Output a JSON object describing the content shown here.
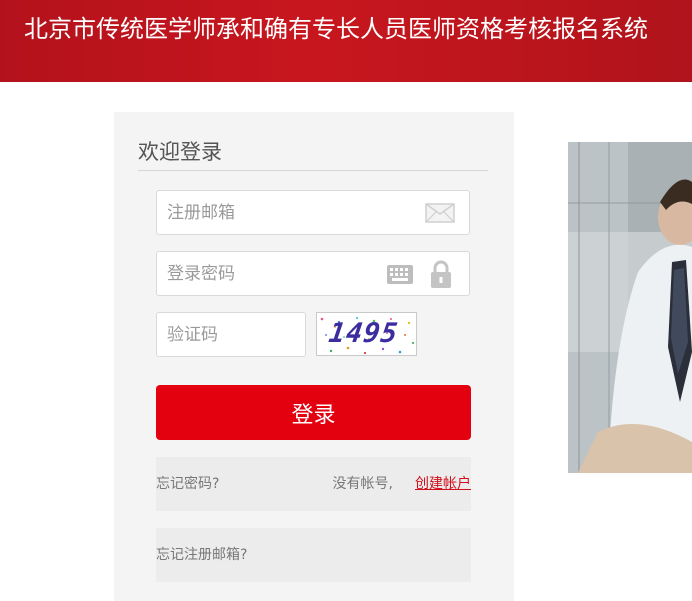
{
  "header": {
    "title": "北京市传统医学师承和确有专长人员医师资格考核报名系统"
  },
  "login": {
    "title": "欢迎登录",
    "email_placeholder": "注册邮箱",
    "password_placeholder": "登录密码",
    "captcha_placeholder": "验证码",
    "captcha_text": "1495",
    "submit_label": "登录",
    "forgot_password": "忘记密码?",
    "no_account": "没有帐号,",
    "create_account": "创建帐户",
    "forgot_email": "忘记注册邮箱?"
  },
  "icons": {
    "email": "mail-icon",
    "keyboard": "keyboard-icon",
    "lock": "lock-icon"
  },
  "colors": {
    "brand_red": "#e3000f",
    "header_red": "#c8161e",
    "link_red": "#d0101c"
  }
}
